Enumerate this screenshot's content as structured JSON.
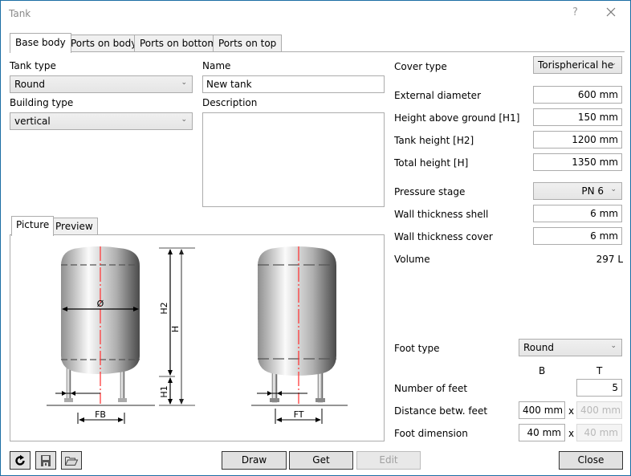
{
  "window": {
    "title": "Tank",
    "help_glyph": "?",
    "close_glyph": "×"
  },
  "tabs": [
    {
      "label": "Base body",
      "active": true
    },
    {
      "label": "Ports on body",
      "active": false
    },
    {
      "label": "Ports on bottom",
      "active": false
    },
    {
      "label": "Ports on top",
      "active": false
    }
  ],
  "left": {
    "tank_type_label": "Tank type",
    "tank_type_value": "Round",
    "building_type_label": "Building type",
    "building_type_value": "vertical",
    "name_label": "Name",
    "name_value": "New tank",
    "description_label": "Description",
    "description_value": ""
  },
  "picture_tabs": [
    {
      "label": "Picture",
      "active": true
    },
    {
      "label": "Preview",
      "active": false
    }
  ],
  "drawing": {
    "labels": {
      "diameter": "Ø",
      "h2": "H2",
      "h": "H",
      "h1": "H1",
      "fb": "FB",
      "ft": "FT"
    },
    "centerline_color": "#ff3b3b"
  },
  "right": {
    "cover_type_label": "Cover type",
    "cover_type_value": "Torispherical he",
    "external_diameter_label": "External diameter",
    "external_diameter_value": "600 mm",
    "height_above_ground_label": "Height above ground [H1]",
    "height_above_ground_value": "150 mm",
    "tank_height_label": "Tank height [H2]",
    "tank_height_value": "1200 mm",
    "total_height_label": "Total height [H]",
    "total_height_value": "1350 mm",
    "pressure_stage_label": "Pressure stage",
    "pressure_stage_value": "PN 6",
    "wall_shell_label": "Wall thickness shell",
    "wall_shell_value": "6 mm",
    "wall_cover_label": "Wall thickness cover",
    "wall_cover_value": "6 mm",
    "volume_label": "Volume",
    "volume_value": "297 L",
    "foot_type_label": "Foot type",
    "foot_type_value": "Round",
    "col_b": "B",
    "col_t": "T",
    "number_of_feet_label": "Number of feet",
    "number_of_feet_value": "5",
    "distance_feet_label": "Distance betw. feet",
    "distance_feet_b": "400 mm",
    "distance_feet_t": "400 mm",
    "foot_dimension_label": "Foot dimension",
    "foot_dimension_b": "40 mm",
    "foot_dimension_t": "40 mm",
    "times": "x"
  },
  "bottom": {
    "draw_label": "Draw",
    "get_label": "Get",
    "edit_label": "Edit",
    "close_label": "Close",
    "icons": [
      "refresh-icon",
      "save-icon",
      "open-folder-icon"
    ]
  }
}
